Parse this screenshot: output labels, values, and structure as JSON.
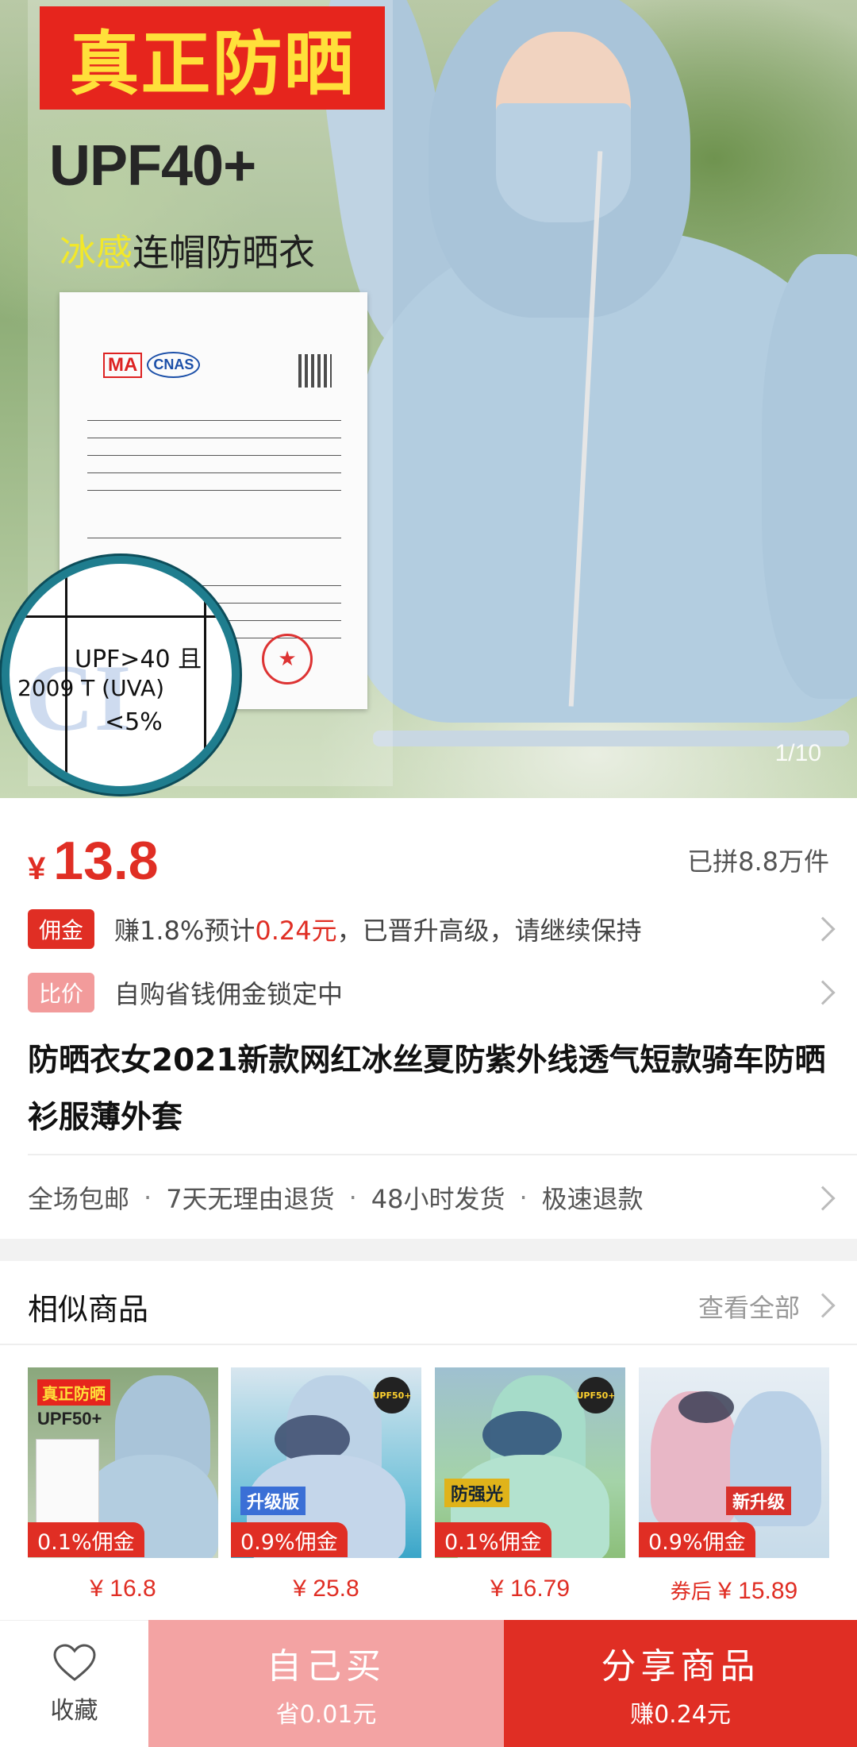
{
  "hero": {
    "banner_text": "真正防晒",
    "upf_text": "UPF40+",
    "subtitle_highlight": "冰感",
    "subtitle_rest": "连帽防晒衣",
    "cert_logo_ma": "MA",
    "cert_logo_cnas": "CNAS",
    "magnifier_line1": "UPF>40 且",
    "magnifier_line2": "2009  T (UVA)",
    "magnifier_line3": "<5%",
    "page_indicator": "1/10"
  },
  "price": {
    "currency": "¥",
    "value": "13.8",
    "sold": "已拼8.8万件"
  },
  "commission": {
    "tag": "佣金",
    "text_before": "赚1.8%预计",
    "amount": "0.24元",
    "text_after": "，已晋升高级，请继续保持"
  },
  "compare": {
    "tag": "比价",
    "text": "自购省钱佣金锁定中"
  },
  "product_title": "防晒衣女2021新款网红冰丝夏防紫外线透气短款骑车防晒衫服薄外套",
  "services": [
    "全场包邮",
    "7天无理由退货",
    "48小时发货",
    "极速退款"
  ],
  "similar": {
    "title": "相似商品",
    "more": "查看全部",
    "items": [
      {
        "badge": "0.1%佣金",
        "price": "¥ 16.8",
        "prefix": "",
        "img_banner": "真正防晒",
        "img_upf": "UPF50+"
      },
      {
        "badge": "0.9%佣金",
        "price": "¥ 25.8",
        "prefix": "",
        "img_label": "升级版",
        "img_sticker": "UPF50+"
      },
      {
        "badge": "0.1%佣金",
        "price": "¥ 16.79",
        "prefix": "",
        "img_label": "防强光",
        "img_sticker": "UPF50+"
      },
      {
        "badge": "0.9%佣金",
        "price": "¥ 15.89",
        "prefix": "券后",
        "img_label": "新升级"
      }
    ]
  },
  "bottom_bar": {
    "favorite": "收藏",
    "buy_label": "自己买",
    "buy_sub": "省0.01元",
    "share_label": "分享商品",
    "share_sub": "赚0.24元"
  },
  "colors": {
    "accent_red": "#e02e24",
    "buy_pink": "#f3a3a3"
  }
}
